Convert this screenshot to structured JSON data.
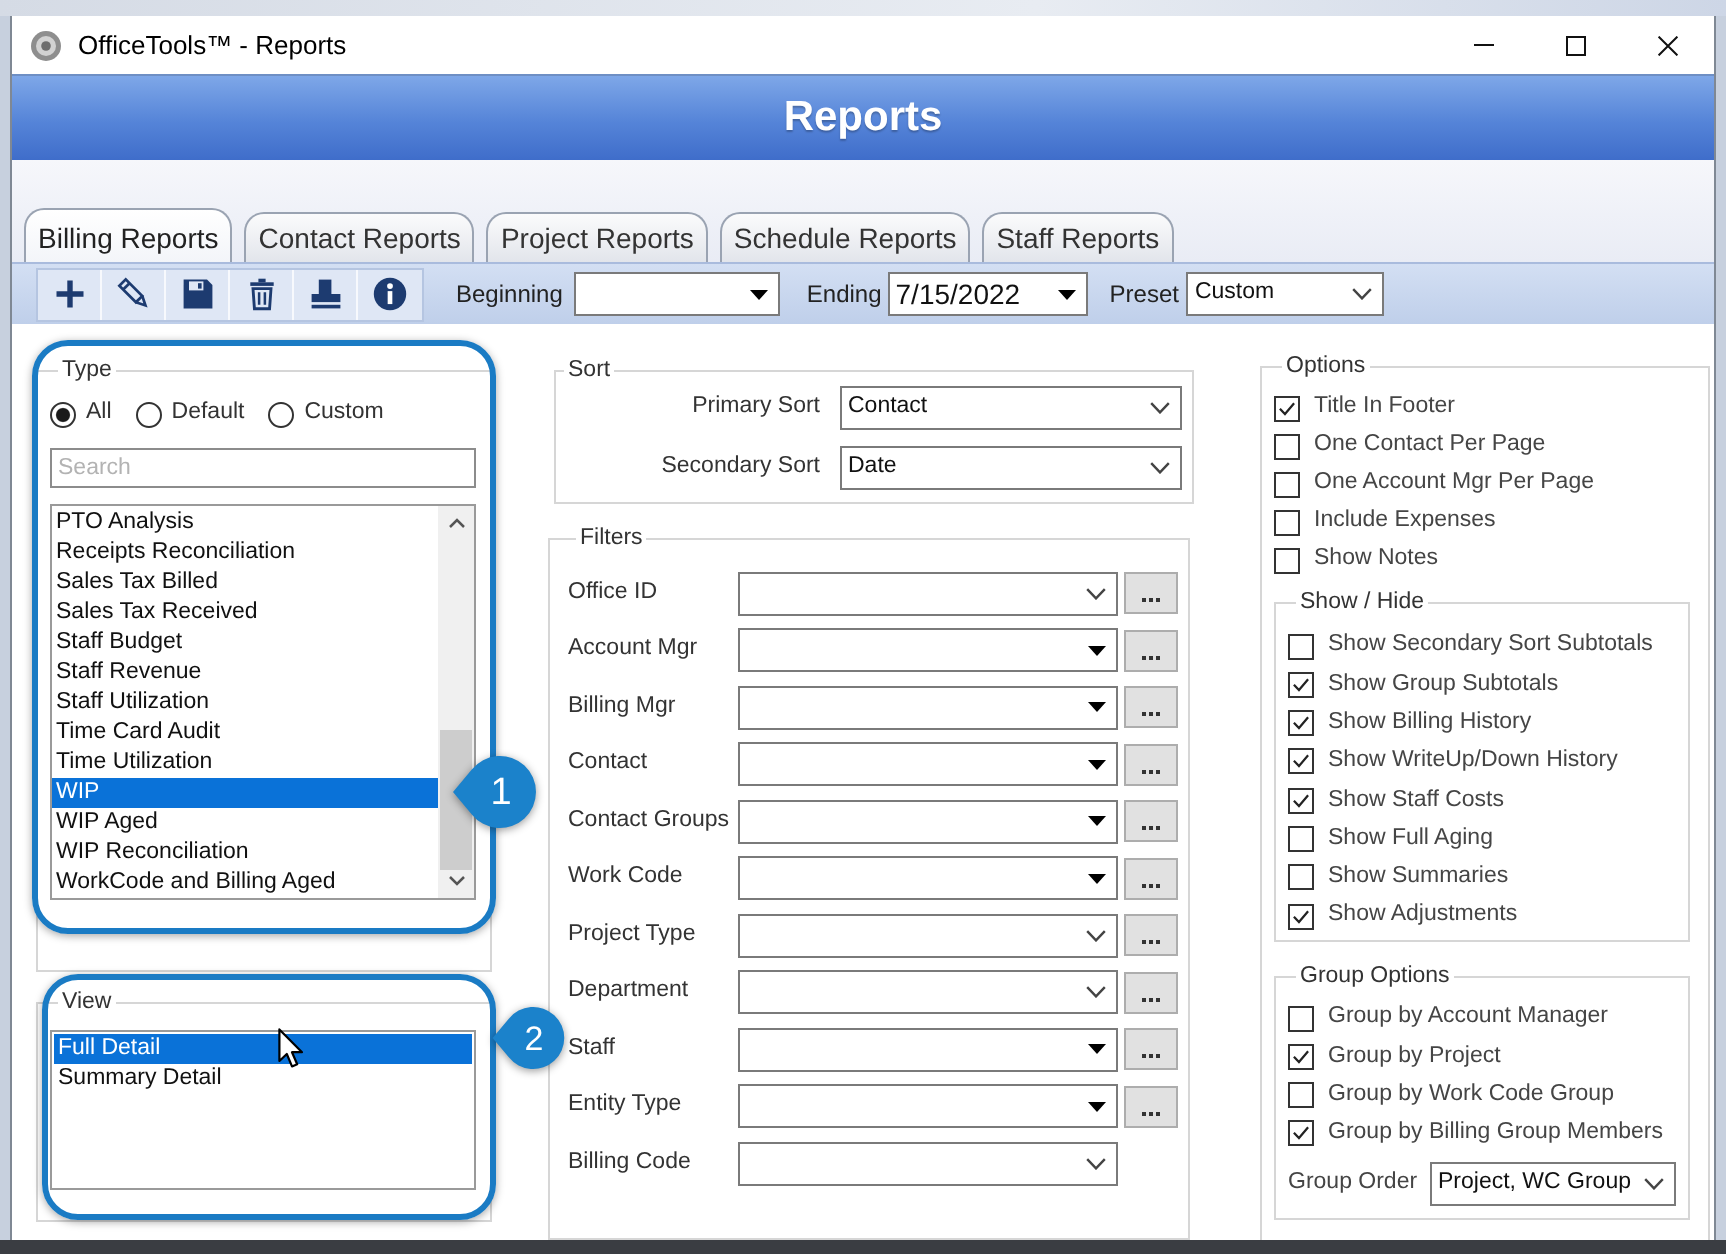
{
  "window": {
    "title": "OfficeTools™ - Reports"
  },
  "header": {
    "title": "Reports"
  },
  "tabs": [
    {
      "label": "Billing Reports",
      "selected": true
    },
    {
      "label": "Contact Reports",
      "selected": false
    },
    {
      "label": "Project Reports",
      "selected": false
    },
    {
      "label": "Schedule Reports",
      "selected": false
    },
    {
      "label": "Staff Reports",
      "selected": false
    }
  ],
  "toolbar": {
    "buttons": [
      {
        "kind": "add"
      },
      {
        "kind": "edit"
      },
      {
        "kind": "save"
      },
      {
        "kind": "delete"
      },
      {
        "kind": "print"
      },
      {
        "kind": "info"
      }
    ],
    "beginning": {
      "label": "Beginning"
    },
    "ending": {
      "label": "Ending",
      "value": "7/15/2022"
    },
    "preset": {
      "label": "Preset",
      "value": "Custom"
    }
  },
  "type_panel": {
    "title": "Type",
    "callout": "1",
    "scope_options": [
      {
        "label": "All",
        "selected": true
      },
      {
        "label": "Default",
        "selected": false
      },
      {
        "label": "Custom",
        "selected": false
      }
    ],
    "search": {
      "placeholder": "Search"
    },
    "reports": [
      {
        "label": "PTO Analysis",
        "selected": false
      },
      {
        "label": "Receipts Reconciliation",
        "selected": false
      },
      {
        "label": "Sales Tax Billed",
        "selected": false
      },
      {
        "label": "Sales Tax Received",
        "selected": false
      },
      {
        "label": "Staff Budget",
        "selected": false
      },
      {
        "label": "Staff Revenue",
        "selected": false
      },
      {
        "label": "Staff Utilization",
        "selected": false
      },
      {
        "label": "Time Card Audit",
        "selected": false
      },
      {
        "label": "Time Utilization",
        "selected": false
      },
      {
        "label": "WIP",
        "selected": true
      },
      {
        "label": "WIP Aged",
        "selected": false
      },
      {
        "label": "WIP Reconciliation",
        "selected": false
      },
      {
        "label": "WorkCode and Billing Aged",
        "selected": false
      }
    ]
  },
  "view_panel": {
    "title": "View",
    "callout": "2",
    "views": [
      {
        "label": "Full Detail",
        "selected": true
      },
      {
        "label": "Summary Detail",
        "selected": false
      }
    ]
  },
  "sort": {
    "title": "Sort",
    "fields": [
      {
        "label": "Primary Sort",
        "value": "Contact"
      },
      {
        "label": "Secondary Sort",
        "value": "Date"
      }
    ]
  },
  "filters": {
    "title": "Filters",
    "fields": [
      {
        "label": "Office ID",
        "kind": "combo",
        "browse_button": true
      },
      {
        "label": "Account Mgr",
        "kind": "list",
        "browse_button": true
      },
      {
        "label": "Billing Mgr",
        "kind": "list",
        "browse_button": true
      },
      {
        "label": "Contact",
        "kind": "list",
        "browse_button": true
      },
      {
        "label": "Contact Groups",
        "kind": "list",
        "browse_button": true
      },
      {
        "label": "Work Code",
        "kind": "list",
        "browse_button": true
      },
      {
        "label": "Project Type",
        "kind": "combo",
        "browse_button": true
      },
      {
        "label": "Department",
        "kind": "combo",
        "browse_button": true
      },
      {
        "label": "Staff",
        "kind": "list",
        "browse_button": true
      },
      {
        "label": "Entity Type",
        "kind": "list",
        "browse_button": true
      },
      {
        "label": "Billing Code",
        "kind": "combo",
        "browse_button": false
      }
    ]
  },
  "options": {
    "title": "Options",
    "items": [
      {
        "label": "Title In Footer",
        "checked": true
      },
      {
        "label": "One Contact Per Page",
        "checked": false
      },
      {
        "label": "One Account Mgr Per Page",
        "checked": false
      },
      {
        "label": "Include Expenses",
        "checked": false
      },
      {
        "label": "Show Notes",
        "checked": false
      }
    ],
    "show_hide": {
      "title": "Show / Hide",
      "items": [
        {
          "label": "Show Secondary Sort Subtotals",
          "checked": false
        },
        {
          "label": "Show Group Subtotals",
          "checked": true
        },
        {
          "label": "Show Billing History",
          "checked": true
        },
        {
          "label": "Show WriteUp/Down History",
          "checked": true
        },
        {
          "label": "Show Staff Costs",
          "checked": true
        },
        {
          "label": "Show Full Aging",
          "checked": false
        },
        {
          "label": "Show Summaries",
          "checked": false
        },
        {
          "label": "Show Adjustments",
          "checked": true
        }
      ]
    },
    "group_options": {
      "title": "Group Options",
      "items": [
        {
          "label": "Group by Account Manager",
          "checked": false
        },
        {
          "label": "Group by Project",
          "checked": true
        },
        {
          "label": "Group by Work Code Group",
          "checked": false
        },
        {
          "label": "Group by Billing Group Members",
          "checked": true
        }
      ],
      "group_order": {
        "label": "Group Order",
        "value": "Project, WC Group"
      }
    }
  }
}
